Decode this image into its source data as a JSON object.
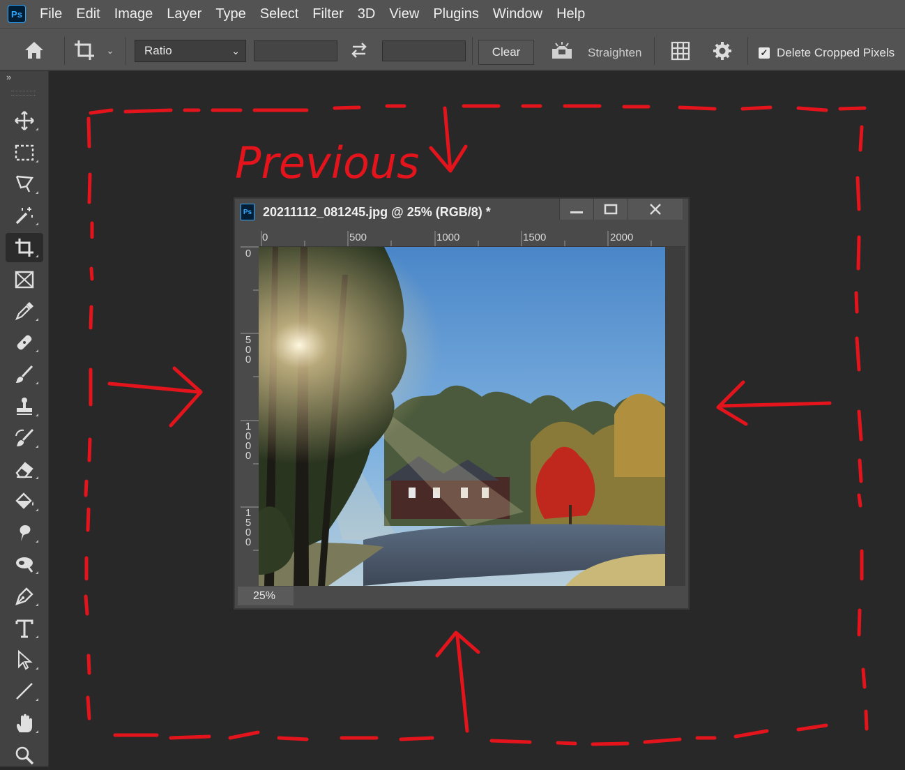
{
  "app": {
    "logo_text": "Ps"
  },
  "menu": [
    "File",
    "Edit",
    "Image",
    "Layer",
    "Type",
    "Select",
    "Filter",
    "3D",
    "View",
    "Plugins",
    "Window",
    "Help"
  ],
  "options": {
    "home_icon": "home-icon",
    "crop_icon": "crop-tool-icon",
    "ratio_select": "Ratio",
    "swap_icon": "swap-arrows-icon",
    "clear_label": "Clear",
    "straighten_label": "Straighten",
    "overlay_icon": "grid-overlay-icon",
    "settings_icon": "gear-icon",
    "delete_cropped_label": "Delete Cropped Pixels",
    "delete_cropped_checked": true
  },
  "toolbar": {
    "tools": [
      {
        "name": "move-tool",
        "icon": "move-icon"
      },
      {
        "name": "marquee-tool",
        "icon": "rect-marquee-icon"
      },
      {
        "name": "lasso-tool",
        "icon": "lasso-icon"
      },
      {
        "name": "magic-wand-tool",
        "icon": "magic-wand-icon"
      },
      {
        "name": "crop-tool",
        "icon": "crop-icon",
        "active": true
      },
      {
        "name": "frame-tool",
        "icon": "frame-icon"
      },
      {
        "name": "eyedropper-tool",
        "icon": "eyedropper-icon"
      },
      {
        "name": "healing-tool",
        "icon": "bandage-icon"
      },
      {
        "name": "brush-tool",
        "icon": "brush-icon"
      },
      {
        "name": "clone-stamp-tool",
        "icon": "stamp-icon"
      },
      {
        "name": "history-brush-tool",
        "icon": "history-brush-icon"
      },
      {
        "name": "eraser-tool",
        "icon": "eraser-icon"
      },
      {
        "name": "paint-bucket-tool",
        "icon": "bucket-icon"
      },
      {
        "name": "smudge-tool",
        "icon": "smudge-icon"
      },
      {
        "name": "dodge-tool",
        "icon": "dodge-icon"
      },
      {
        "name": "pen-tool",
        "icon": "pen-icon"
      },
      {
        "name": "type-tool",
        "icon": "type-icon"
      },
      {
        "name": "path-selection-tool",
        "icon": "arrow-cursor-icon"
      },
      {
        "name": "line-tool",
        "icon": "line-icon"
      },
      {
        "name": "hand-tool",
        "icon": "hand-icon"
      },
      {
        "name": "zoom-tool",
        "icon": "zoom-icon"
      }
    ]
  },
  "document": {
    "title": "20211112_081245.jpg @ 25% (RGB/8) *",
    "zoom": "25%",
    "hruler_labels": [
      "0",
      "500",
      "1000",
      "1500",
      "2000"
    ],
    "vruler_labels": [
      "0",
      "500",
      "1000",
      "1500"
    ]
  },
  "annotation": {
    "text": "Previous",
    "color": "#e3141c"
  }
}
